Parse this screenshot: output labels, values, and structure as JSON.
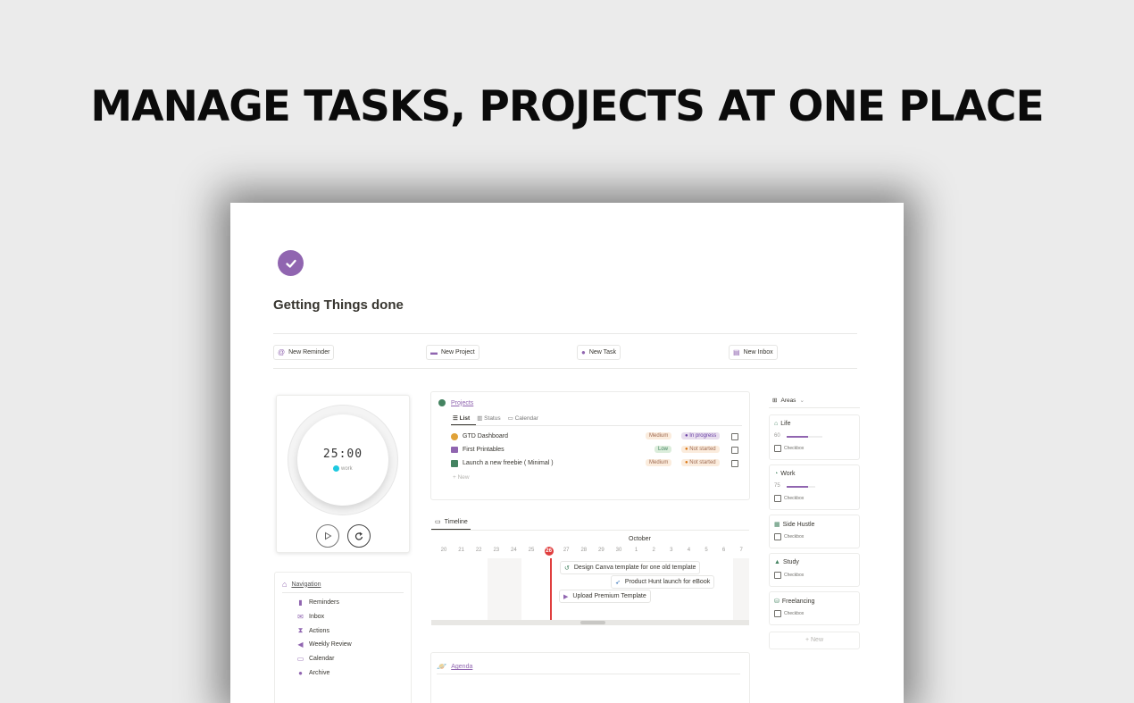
{
  "headline": "MANAGE TASKS, PROJECTS AT ONE PLACE",
  "page": {
    "title": "Getting Things done"
  },
  "quick_buttons": [
    {
      "label": "New Reminder",
      "icon": "at-icon"
    },
    {
      "label": "New Project",
      "icon": "folder-icon"
    },
    {
      "label": "New Task",
      "icon": "check-circle-icon"
    },
    {
      "label": "New Inbox",
      "icon": "archive-box-icon"
    }
  ],
  "timer": {
    "time": "25:00",
    "mode": "work",
    "mode_color": "#1ec9e0"
  },
  "projects": {
    "title": "Projects",
    "views": [
      "List",
      "Status",
      "Calendar"
    ],
    "rows": [
      {
        "name": "GTD Dashboard",
        "priority": "Medium",
        "status": "In progress"
      },
      {
        "name": "First Printables",
        "priority": "Low",
        "status": "Not started"
      },
      {
        "name": "Launch a new freebie ( Minimal )",
        "priority": "Medium",
        "status": "Not started"
      }
    ],
    "new_label": "New"
  },
  "timeline": {
    "label": "Timeline",
    "month": "October",
    "days": [
      "20",
      "21",
      "22",
      "23",
      "24",
      "25",
      "26",
      "27",
      "28",
      "29",
      "30",
      "1",
      "2",
      "3",
      "4",
      "5",
      "6",
      "7"
    ],
    "today": "26",
    "items": [
      "Design Canva template for one old template",
      "Product Hunt launch for eBook",
      "Upload Premium Template"
    ]
  },
  "agenda": {
    "label": "Agenda"
  },
  "navigation": {
    "title": "Navigation",
    "items": [
      {
        "label": "Reminders",
        "icon": "bookmark-icon"
      },
      {
        "label": "Inbox",
        "icon": "inbox-icon"
      },
      {
        "label": "Actions",
        "icon": "hourglass-icon"
      },
      {
        "label": "Weekly Review",
        "icon": "megaphone-icon"
      },
      {
        "label": "Calendar",
        "icon": "calendar-icon"
      },
      {
        "label": "Archive",
        "icon": "archive-icon"
      }
    ]
  },
  "areas": {
    "title": "Areas",
    "cards": [
      {
        "name": "Life",
        "value": "60",
        "progress": 0.6,
        "checkbox": "Checkbox"
      },
      {
        "name": "Work",
        "value": "75",
        "progress": 0.75,
        "checkbox": "Checkbox"
      },
      {
        "name": "Side Hustle",
        "checkbox": "Checkbox"
      },
      {
        "name": "Study",
        "checkbox": "Checkbox"
      },
      {
        "name": "Freelancing",
        "checkbox": "Checkbox"
      }
    ],
    "new_label": "+ New"
  },
  "colors": {
    "accent": "#9065b0",
    "today": "#e03e3e",
    "medium_bg": "#fbecdd",
    "low_bg": "#dbeddb",
    "progress_bg": "#e8deee",
    "notstarted_bg": "#fbecdd"
  }
}
